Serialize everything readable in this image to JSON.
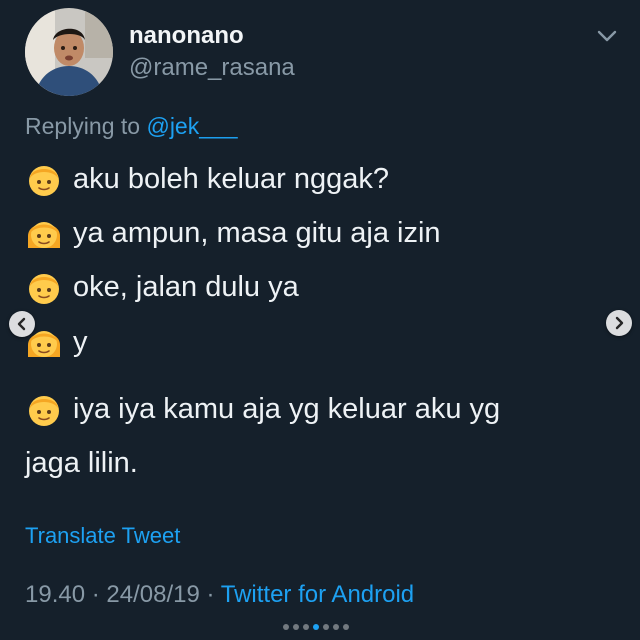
{
  "tweet": {
    "display_name": "nanonano",
    "handle": "@rame_rasana",
    "replying_prefix": "Replying to",
    "replying_mention": "@jek___",
    "lines": [
      {
        "face": "boy-face-icon",
        "text": "aku boleh keluar nggak?"
      },
      {
        "face": "girl-face-icon",
        "text": "ya ampun, masa gitu aja izin"
      },
      {
        "face": "boy-face-icon",
        "text": "oke, jalan dulu ya"
      },
      {
        "face": "girl-face-icon",
        "text": "y"
      },
      {
        "face": "boy-face-icon",
        "text": "iya iya kamu aja yg keluar aku yg"
      }
    ],
    "wrap_line": "jaga lilin.",
    "translate_label": "Translate Tweet",
    "time": "19.40",
    "date": "24/08/19",
    "separator": "·",
    "source": "Twitter for Android"
  },
  "carousel": {
    "dot_count": 7,
    "active_index": 3
  },
  "colors": {
    "background": "#15202b",
    "accent": "#1da1f2",
    "muted": "#8899a6"
  }
}
